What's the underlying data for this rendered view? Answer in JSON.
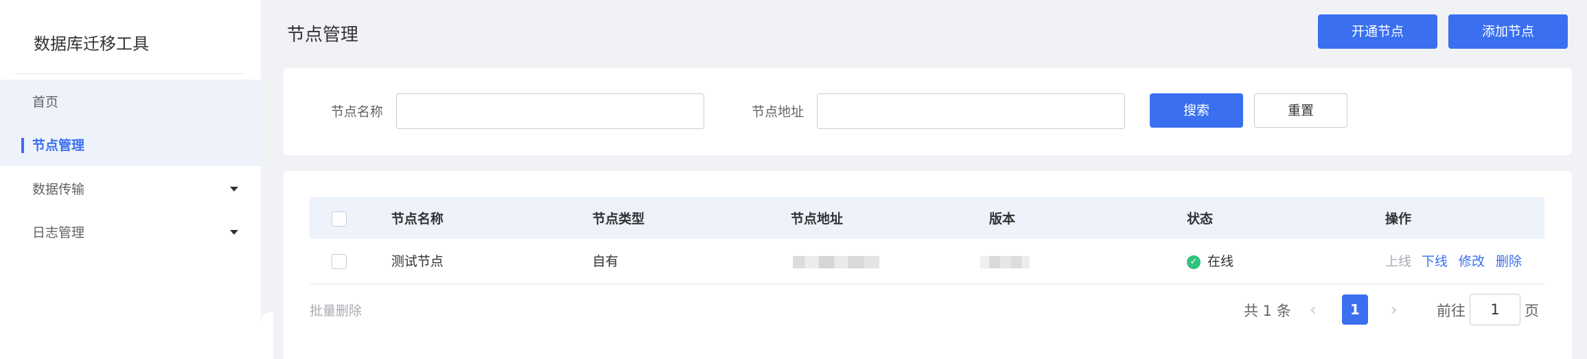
{
  "sidebar": {
    "app_title": "数据库迁移工具",
    "items": [
      {
        "label": "首页"
      },
      {
        "label": "节点管理"
      },
      {
        "label": "数据传输"
      },
      {
        "label": "日志管理"
      }
    ]
  },
  "header": {
    "title": "节点管理",
    "open_node_label": "开通节点",
    "add_node_label": "添加节点"
  },
  "search": {
    "name_label": "节点名称",
    "name_value": "",
    "address_label": "节点地址",
    "address_value": "",
    "search_label": "搜索",
    "reset_label": "重置"
  },
  "table": {
    "columns": [
      "节点名称",
      "节点类型",
      "节点地址",
      "版本",
      "状态",
      "操作"
    ],
    "rows": [
      {
        "name": "测试节点",
        "type": "自有",
        "status": "在线",
        "actions": [
          "上线",
          "下线",
          "修改",
          "删除"
        ]
      }
    ]
  },
  "footer": {
    "batch_delete_label": "批量删除",
    "total_text": "共 1 条",
    "current_page": "1",
    "goto_label": "前往",
    "goto_value": "1",
    "page_suffix": "页"
  },
  "colors": {
    "primary": "#3a6ff0",
    "success": "#2fc37d",
    "background": "#f0f2f5"
  }
}
